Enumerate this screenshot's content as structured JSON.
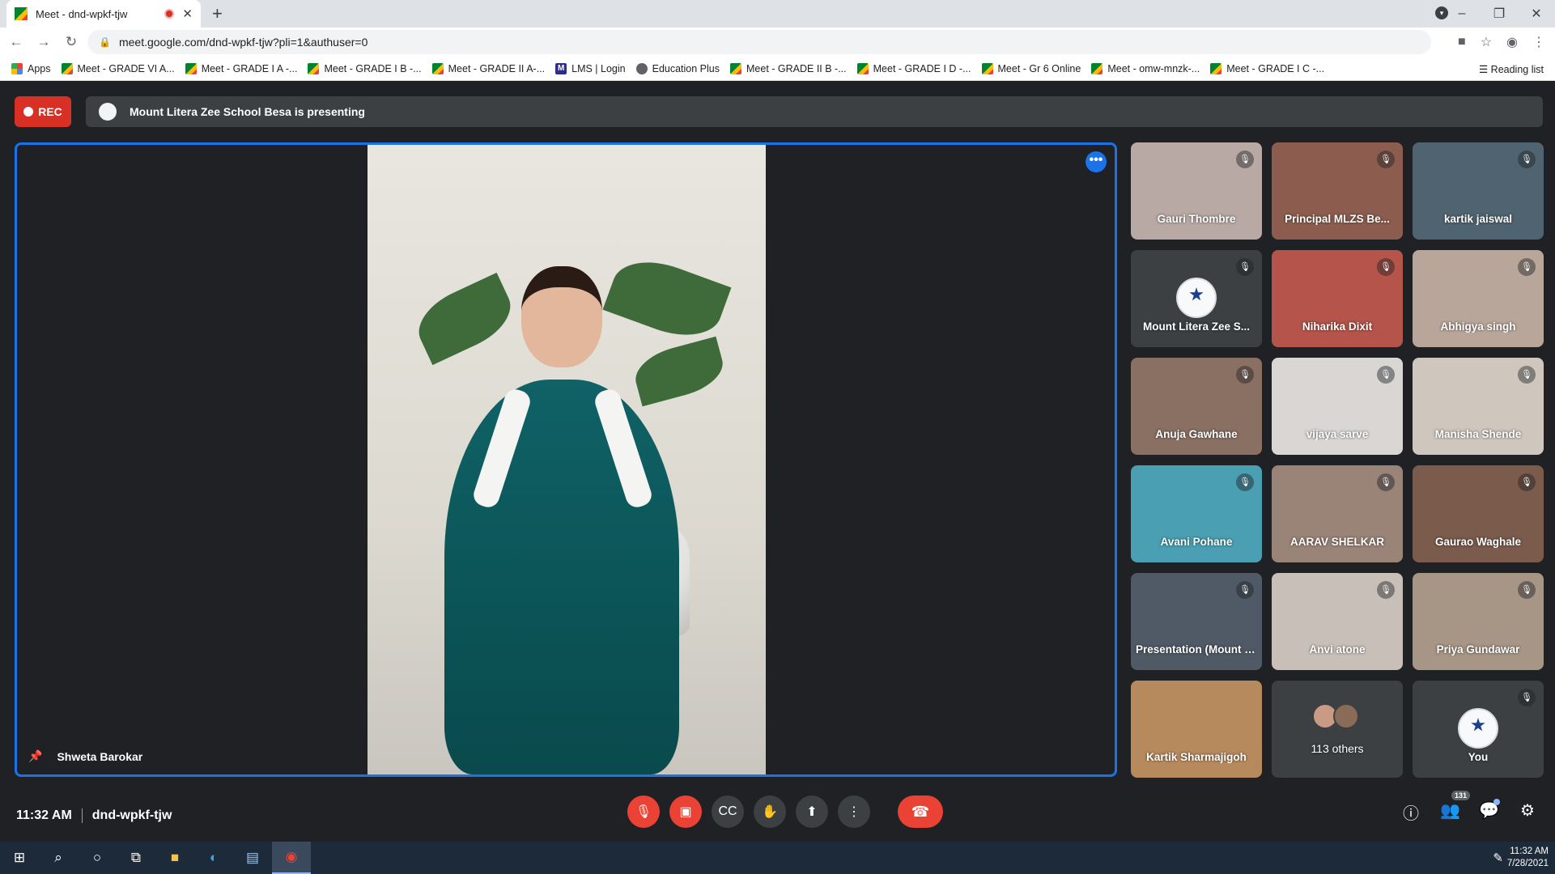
{
  "browser": {
    "tab_title": "Meet - dnd-wpkf-tjw",
    "tab_close": "✕",
    "new_tab": "+",
    "url": "meet.google.com/dnd-wpkf-tjw?pli=1&authuser=0",
    "bookmarks": [
      {
        "label": "Apps",
        "icon": "apps"
      },
      {
        "label": "Meet - GRADE VI A...",
        "icon": "meet"
      },
      {
        "label": "Meet - GRADE I A -...",
        "icon": "meet"
      },
      {
        "label": "Meet - GRADE I B -...",
        "icon": "meet"
      },
      {
        "label": "Meet - GRADE II A-...",
        "icon": "meet"
      },
      {
        "label": "LMS | Login",
        "icon": "lms"
      },
      {
        "label": "Education Plus",
        "icon": "edu"
      },
      {
        "label": "Meet - GRADE II B -...",
        "icon": "meet"
      },
      {
        "label": "Meet - GRADE I D -...",
        "icon": "meet"
      },
      {
        "label": "Meet - Gr 6 Online",
        "icon": "meet"
      },
      {
        "label": "Meet - omw-mnzk-...",
        "icon": "meet"
      },
      {
        "label": "Meet - GRADE I C -...",
        "icon": "meet"
      }
    ],
    "reading_list": "Reading list"
  },
  "meet": {
    "rec_label": "REC",
    "presenting_text": "Mount Litera Zee School Besa is presenting",
    "stage_name": "Shweta Barokar",
    "stage_more": "•••",
    "time": "11:32 AM",
    "meeting_code": "dnd-wpkf-tjw",
    "participants_count": "131",
    "tiles": [
      {
        "name": "Gauri Thombre",
        "bg": "#b9a9a4"
      },
      {
        "name": "Principal MLZS Be...",
        "bg": "#8c5d4e"
      },
      {
        "name": "kartik jaiswal",
        "bg": "#4f6470"
      },
      {
        "name": "Mount Litera Zee S...",
        "bg": "#3c4043",
        "logo": true
      },
      {
        "name": "Niharika Dixit",
        "bg": "#b4544a"
      },
      {
        "name": "Abhigya singh",
        "bg": "#b8a69a"
      },
      {
        "name": "Anuja Gawhane",
        "bg": "#8a6f63"
      },
      {
        "name": "vijaya sarve",
        "bg": "#d9d6d4"
      },
      {
        "name": "Manisha Shende",
        "bg": "#cfc6bd"
      },
      {
        "name": "Avani Pohane",
        "bg": "#4a9fb3"
      },
      {
        "name": "AARAV SHELKAR",
        "bg": "#9a8478"
      },
      {
        "name": "Gaurao Waghale",
        "bg": "#7a5b4c"
      },
      {
        "name": "Presentation (Mount Liter...",
        "bg": "#505a66"
      },
      {
        "name": "Anvi atone",
        "bg": "#c8c0b8"
      },
      {
        "name": "Priya Gundawar",
        "bg": "#a79585"
      },
      {
        "name": "Kartik Sharmajigoh",
        "bg": "#b78a5e"
      },
      {
        "name": "113 others",
        "bg": "#3c4043",
        "others": true
      },
      {
        "name": "You",
        "bg": "#3c4043",
        "logo": true
      }
    ]
  },
  "taskbar": {
    "time": "11:32 AM",
    "date": "7/28/2021"
  }
}
